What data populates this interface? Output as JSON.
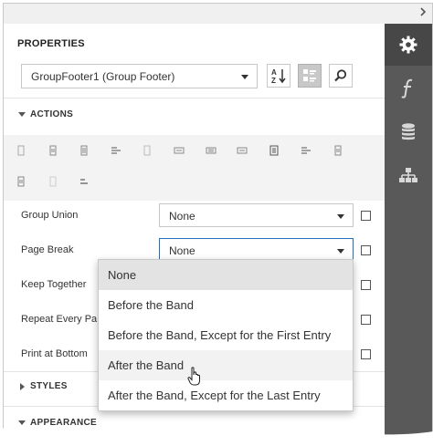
{
  "panel": {
    "title": "PROPERTIES",
    "selector_value": "GroupFooter1 (Group Footer)",
    "toolbar": {
      "sort_icon": "sort-alphabetical-icon",
      "categories_icon": "categorized-view-icon",
      "search_icon": "search-icon"
    }
  },
  "sidebar": {
    "tabs": [
      {
        "icon": "gear-icon",
        "active": true
      },
      {
        "icon": "function-icon",
        "active": false
      },
      {
        "icon": "database-icon",
        "active": false
      },
      {
        "icon": "hierarchy-icon",
        "active": false
      }
    ]
  },
  "categories": {
    "actions": "ACTIONS",
    "styles": "STYLES",
    "appearance": "APPEARANCE"
  },
  "properties": [
    {
      "label": "Group Union",
      "value": "None"
    },
    {
      "label": "Page Break",
      "value": "None"
    },
    {
      "label": "Keep Together",
      "value": ""
    },
    {
      "label": "Repeat Every Pa",
      "value": ""
    },
    {
      "label": "Print at Bottom",
      "value": ""
    }
  ],
  "dropdown": {
    "options": [
      "None",
      "Before the Band",
      "Before the Band, Except for the First Entry",
      "After the Band",
      "After the Band, Except for the Last Entry"
    ],
    "selected_index": 0,
    "hover_index": 3
  },
  "colors": {
    "sidebar": "#595959",
    "sidebar_active": "#474747",
    "accent_focus": "#1e6fbf"
  }
}
